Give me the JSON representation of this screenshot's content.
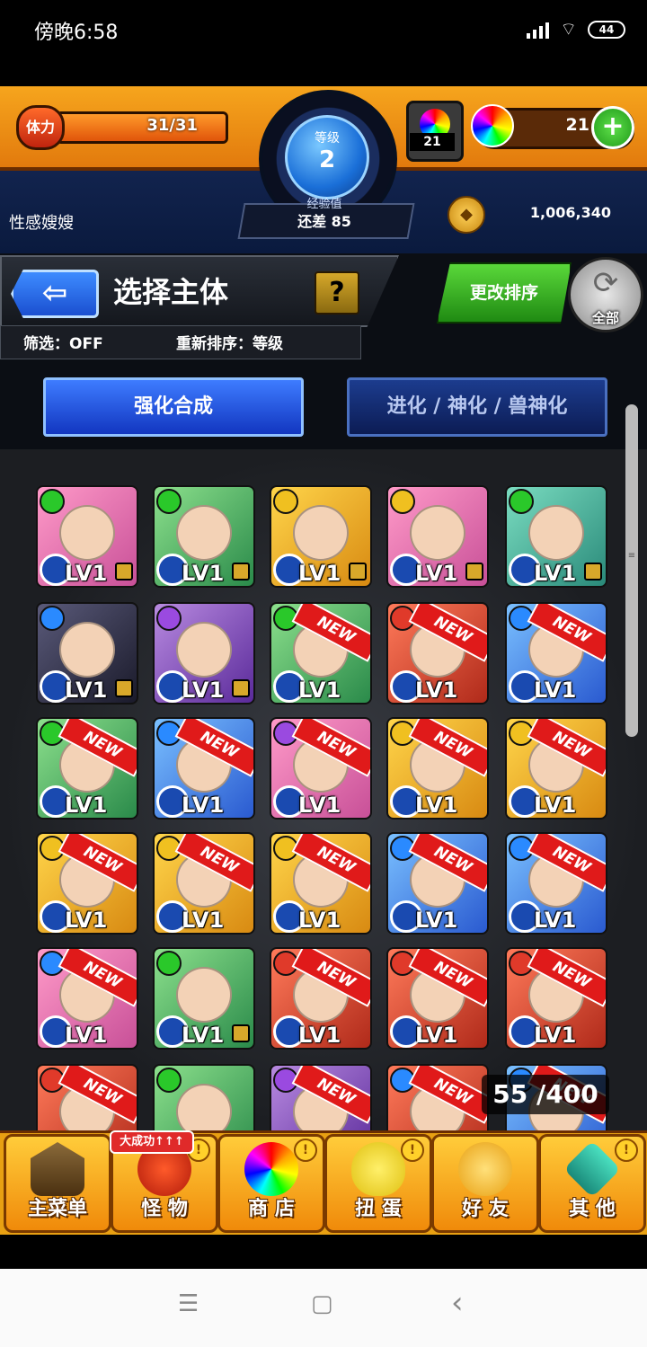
{
  "status_bar": {
    "time": "傍晚6:58",
    "battery": "44"
  },
  "header": {
    "stamina_label": "体力",
    "stamina_value": "31/31",
    "stamina_ratio": 1.0,
    "level_label": "等级",
    "level_value": "2",
    "exp_label": "经验值",
    "exp_remaining": "还差 85",
    "orb_count": "21",
    "gem_count": "21",
    "player_name": "性感嫂嫂",
    "coin_amount": "1,006,340"
  },
  "title_panel": {
    "title": "选择主体",
    "help": "?",
    "filter": "筛选：OFF",
    "sort": "重新排序：等级",
    "change_sort_button": "更改排序",
    "all_button": "全部"
  },
  "modes": {
    "active": "强化合成",
    "inactive": "进化 / 神化 / 兽神化"
  },
  "monster_grid": {
    "cards": [
      {
        "level": "LV1",
        "element": "green",
        "bg": "pink",
        "locked": true,
        "new": false
      },
      {
        "level": "LV1",
        "element": "green",
        "bg": "green",
        "locked": true,
        "new": false
      },
      {
        "level": "LV1",
        "element": "yellow",
        "bg": "yellow",
        "locked": true,
        "new": false
      },
      {
        "level": "LV1",
        "element": "yellow",
        "bg": "pink",
        "locked": true,
        "new": false
      },
      {
        "level": "LV1",
        "element": "green",
        "bg": "teal",
        "locked": true,
        "new": false
      },
      {
        "level": "LV1",
        "element": "blue",
        "bg": "dark",
        "locked": true,
        "new": false
      },
      {
        "level": "LV1",
        "element": "purple",
        "bg": "purple",
        "locked": true,
        "new": false
      },
      {
        "level": "LV1",
        "element": "green",
        "bg": "green",
        "locked": false,
        "new": true
      },
      {
        "level": "LV1",
        "element": "red",
        "bg": "red",
        "locked": false,
        "new": true
      },
      {
        "level": "LV1",
        "element": "blue",
        "bg": "blue",
        "locked": false,
        "new": true
      },
      {
        "level": "LV1",
        "element": "green",
        "bg": "green",
        "locked": false,
        "new": true
      },
      {
        "level": "LV1",
        "element": "blue",
        "bg": "blue",
        "locked": false,
        "new": true
      },
      {
        "level": "LV1",
        "element": "purple",
        "bg": "pink",
        "locked": false,
        "new": true
      },
      {
        "level": "LV1",
        "element": "yellow",
        "bg": "yellow",
        "locked": false,
        "new": true
      },
      {
        "level": "LV1",
        "element": "yellow",
        "bg": "yellow",
        "locked": false,
        "new": true
      },
      {
        "level": "LV1",
        "element": "yellow",
        "bg": "yellow",
        "locked": false,
        "new": true
      },
      {
        "level": "LV1",
        "element": "yellow",
        "bg": "yellow",
        "locked": false,
        "new": true
      },
      {
        "level": "LV1",
        "element": "yellow",
        "bg": "yellow",
        "locked": false,
        "new": true
      },
      {
        "level": "LV1",
        "element": "blue",
        "bg": "blue",
        "locked": false,
        "new": true
      },
      {
        "level": "LV1",
        "element": "blue",
        "bg": "blue",
        "locked": false,
        "new": true
      },
      {
        "level": "LV1",
        "element": "blue",
        "bg": "pink",
        "locked": false,
        "new": true
      },
      {
        "level": "LV1",
        "element": "green",
        "bg": "green",
        "locked": true,
        "new": false
      },
      {
        "level": "LV1",
        "element": "red",
        "bg": "red",
        "locked": false,
        "new": true
      },
      {
        "level": "LV1",
        "element": "red",
        "bg": "red",
        "locked": false,
        "new": true
      },
      {
        "level": "LV1",
        "element": "red",
        "bg": "red",
        "locked": false,
        "new": true
      },
      {
        "level": "",
        "element": "red",
        "bg": "red",
        "locked": false,
        "new": true
      },
      {
        "level": "",
        "element": "green",
        "bg": "green",
        "locked": false,
        "new": false
      },
      {
        "level": "",
        "element": "purple",
        "bg": "purple",
        "locked": false,
        "new": true
      },
      {
        "level": "",
        "element": "blue",
        "bg": "red",
        "locked": false,
        "new": true
      },
      {
        "level": "",
        "element": "blue",
        "bg": "blue",
        "locked": false,
        "new": true
      }
    ],
    "new_label": "NEW",
    "box_count": "55 /400"
  },
  "bottom_nav": {
    "items": [
      {
        "label": "主菜单",
        "alert": false
      },
      {
        "label": "怪 物",
        "alert": true
      },
      {
        "label": "商 店",
        "alert": true
      },
      {
        "label": "扭 蛋",
        "alert": true
      },
      {
        "label": "好 友",
        "alert": false
      },
      {
        "label": "其 他",
        "alert": true
      }
    ],
    "promo": "大成功↑↑↑"
  },
  "system_nav": {
    "menu": "☰",
    "home": "▢",
    "back": "‹"
  }
}
